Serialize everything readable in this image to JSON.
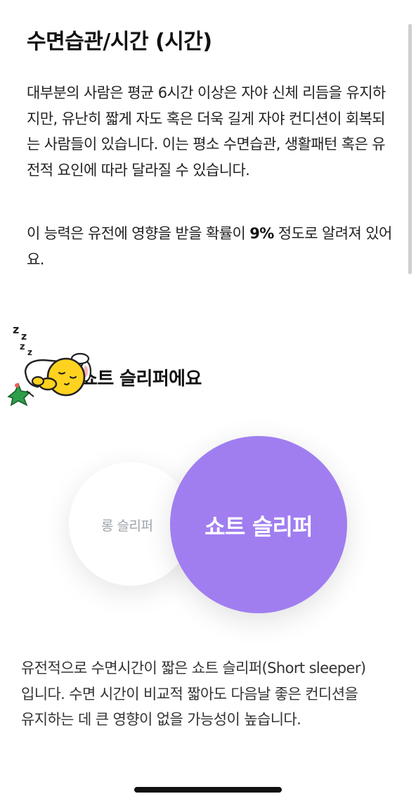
{
  "header": {
    "title": "수면습관/시간 (시간)"
  },
  "intro": {
    "text": "대부분의 사람은 평균 6시간 이상은 자야 신체 리듬을 유지하지만, 유난히 짧게 자도 혹은 더욱 길게 자야 컨디션이 회복되는 사람들이 있습니다. 이는 평소 수면습관, 생활패턴 혹은 유전적 요인에 따라 달라질 수 있습니다."
  },
  "heredity": {
    "prefix": "이 능력은 유전에 영향을 받을 확률이 ",
    "value": "9%",
    "suffix": " 정도로 알려져 있어요."
  },
  "result": {
    "title": "님은 쇼트 슬리퍼에요",
    "mascot_icon": "sleeping-mascot-icon"
  },
  "options": {
    "long": "롱 슬리퍼",
    "short": "쇼트 슬리퍼",
    "long_color": "#ffffff",
    "short_color": "#a07ef0"
  },
  "description": {
    "text": "유전적으로 수면시간이 짧은 쇼트 슬리퍼(Short sleeper)입니다. 수면 시간이 비교적 짧아도 다음날 좋은 컨디션을 유지하는 데 큰 영향이 없을 가능성이 높습니다."
  }
}
